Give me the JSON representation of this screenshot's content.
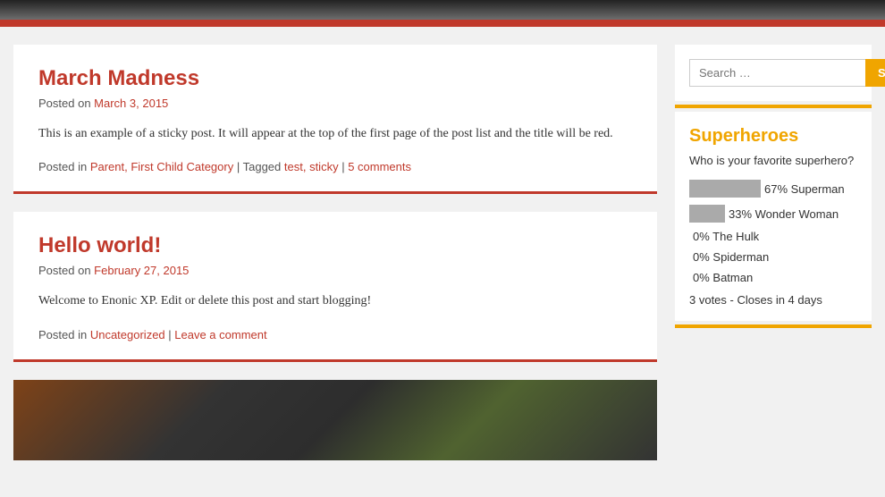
{
  "header": {
    "alt": "Site header banner"
  },
  "posts": [
    {
      "id": "post-1",
      "title": "March Madness",
      "posted_on_label": "Posted on",
      "date": "March 3, 2015",
      "content": "This is an example of a sticky post. It will appear at the top of the first page of the post list and the title will be red.",
      "footer_posted_in": "Posted in",
      "categories": "Parent, First Child Category",
      "tagged_label": "Tagged",
      "tags": "test, sticky",
      "comments": "5 comments"
    },
    {
      "id": "post-2",
      "title": "Hello world!",
      "posted_on_label": "Posted on",
      "date": "February 27, 2015",
      "content": "Welcome to Enonic XP. Edit or delete this post and start blogging!",
      "footer_posted_in": "Posted in",
      "categories": "Uncategorized",
      "leave_comment": "Leave a comment"
    }
  ],
  "search": {
    "placeholder": "Search …",
    "button_label": "Search"
  },
  "poll": {
    "title": "Superheroes",
    "question": "Who is your favorite superhero?",
    "options": [
      {
        "percent": 67,
        "label": "Superman",
        "has_bar": true
      },
      {
        "percent": 33,
        "label": "Wonder Woman",
        "has_bar": true
      },
      {
        "percent": 0,
        "label": "The Hulk",
        "has_bar": false
      },
      {
        "percent": 0,
        "label": "Spiderman",
        "has_bar": false
      },
      {
        "percent": 0,
        "label": "Batman",
        "has_bar": false
      }
    ],
    "votes_info": "3 votes - Closes in 4 days"
  }
}
